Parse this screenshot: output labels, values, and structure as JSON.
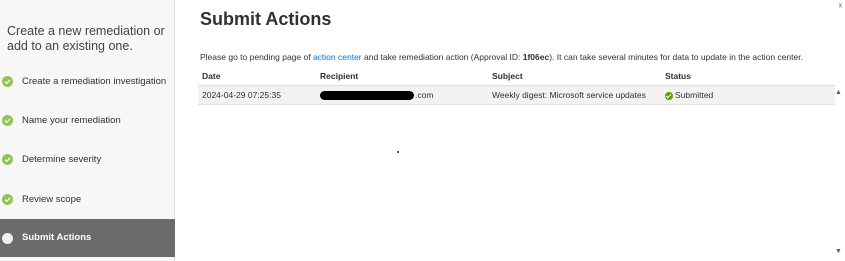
{
  "sidebar": {
    "heading": "Create a new remediation or add to an existing one.",
    "steps": [
      {
        "label": "Create a remediation investigation",
        "state": "complete"
      },
      {
        "label": "Name your remediation",
        "state": "complete"
      },
      {
        "label": "Determine severity",
        "state": "complete"
      },
      {
        "label": "Review scope",
        "state": "complete"
      },
      {
        "label": "Submit Actions",
        "state": "current"
      }
    ]
  },
  "main": {
    "title": "Submit Actions",
    "close_icon": "close-icon",
    "notice": {
      "prefix": "Please go to pending page of ",
      "link": "action center",
      "middle": " and take remediation action (Approval ID: ",
      "approval_id": "1f06ec",
      "suffix": "). It can take several minutes for data to update in the action center."
    },
    "table": {
      "headers": [
        "Date",
        "Recipient",
        "Subject",
        "Status"
      ],
      "rows": [
        {
          "date": "2024-04-29 07:25:35",
          "recipient_suffix": ".com",
          "subject": "Weekly digest: Microsoft service updates",
          "status": "Submitted"
        }
      ]
    }
  },
  "colors": {
    "complete": "#92c353",
    "accent_link": "#0078d4",
    "active_step_bg": "#6b6b6b",
    "status_ok": "#57a300"
  }
}
